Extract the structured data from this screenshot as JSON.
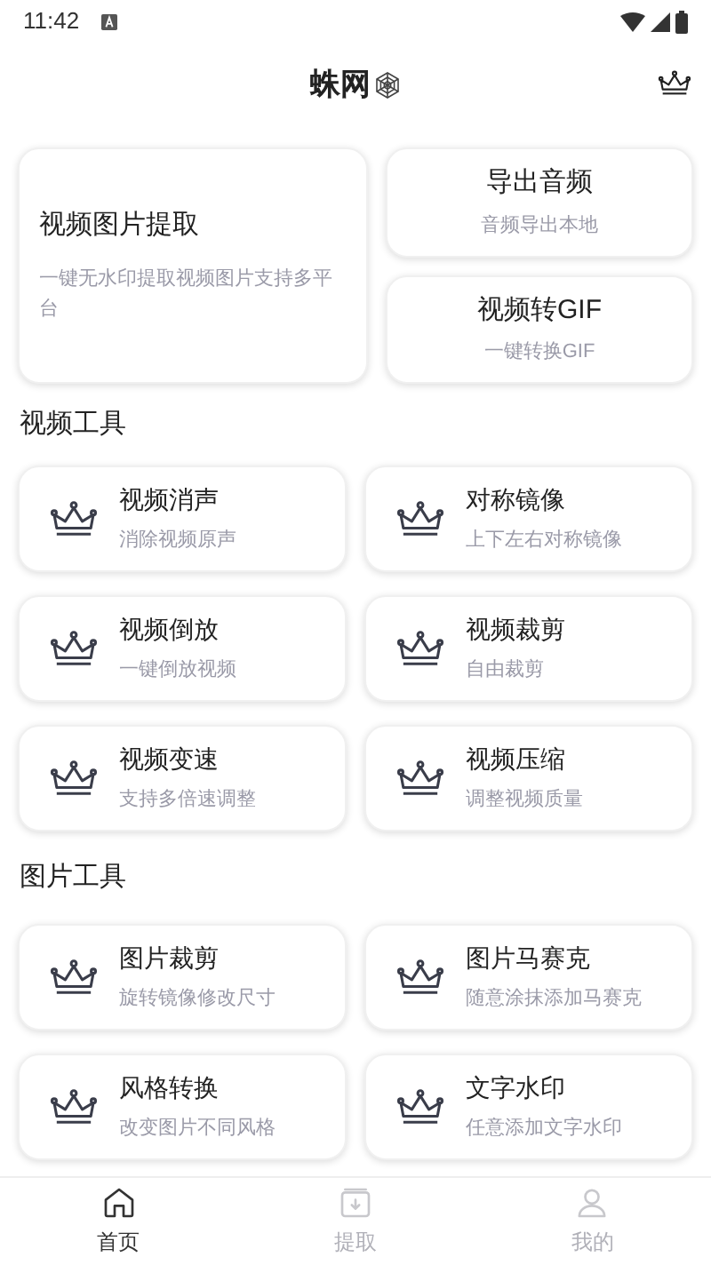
{
  "status_bar": {
    "time": "11:42"
  },
  "header": {
    "title": "蛛网"
  },
  "featured": [
    {
      "title": "视频图片提取",
      "subtitle": "一键无水印提取视频图片支持多平台"
    },
    {
      "title": "导出音频",
      "subtitle": "音频导出本地"
    },
    {
      "title": "视频转GIF",
      "subtitle": "一键转换GIF"
    }
  ],
  "sections": [
    {
      "title": "视频工具",
      "tools": [
        {
          "title": "视频消声",
          "subtitle": "消除视频原声"
        },
        {
          "title": "对称镜像",
          "subtitle": "上下左右对称镜像"
        },
        {
          "title": "视频倒放",
          "subtitle": "一键倒放视频"
        },
        {
          "title": "视频裁剪",
          "subtitle": "自由裁剪"
        },
        {
          "title": "视频变速",
          "subtitle": "支持多倍速调整"
        },
        {
          "title": "视频压缩",
          "subtitle": "调整视频质量"
        }
      ]
    },
    {
      "title": "图片工具",
      "tools": [
        {
          "title": "图片裁剪",
          "subtitle": "旋转镜像修改尺寸"
        },
        {
          "title": "图片马赛克",
          "subtitle": "随意涂抹添加马赛克"
        },
        {
          "title": "风格转换",
          "subtitle": "改变图片不同风格"
        },
        {
          "title": "文字水印",
          "subtitle": "任意添加文字水印"
        }
      ]
    }
  ],
  "bottom_nav": [
    {
      "label": "首页",
      "kind": "home",
      "selected": true
    },
    {
      "label": "提取",
      "kind": "extract",
      "selected": false
    },
    {
      "label": "我的",
      "kind": "profile",
      "selected": false
    }
  ]
}
